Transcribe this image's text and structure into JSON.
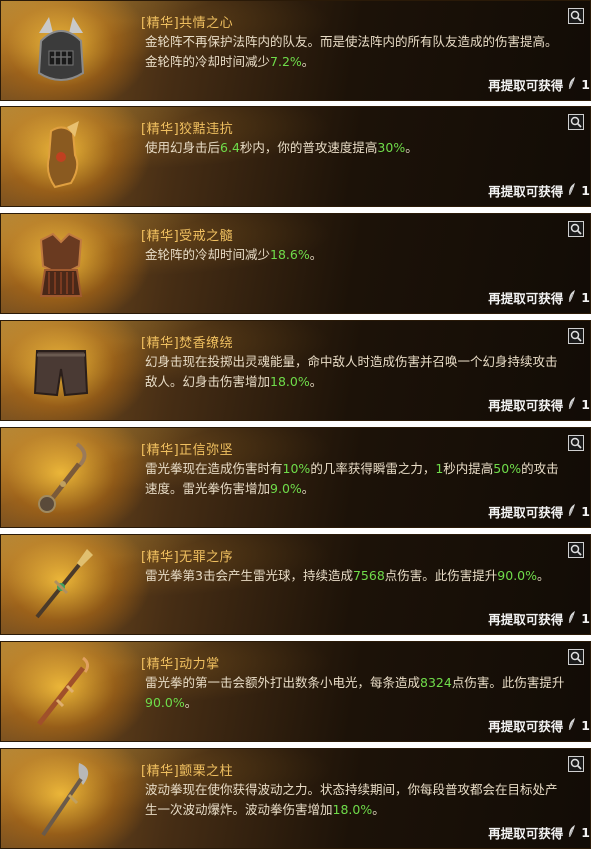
{
  "extract_label": "再提取可获得",
  "extract_count": "1",
  "icons": {
    "search": "search-icon",
    "currency": "feather-icon"
  },
  "colors": {
    "highlight": "#6fdc4a",
    "title": "#f0c060",
    "text": "#e8dcc6"
  },
  "cards": [
    {
      "title": "[精华]共情之心",
      "item_icon": "helmet-icon",
      "desc": [
        {
          "t": "金轮阵不再保护法阵内的队友。而是使法阵内的所有队友造成的伤害提高。金轮阵的冷却时间减少"
        },
        {
          "t": "7.2%",
          "hl": true
        },
        {
          "t": "。"
        }
      ]
    },
    {
      "title": "[精华]狡黠违抗",
      "item_icon": "gloves-icon",
      "desc": [
        {
          "t": "使用幻身击后"
        },
        {
          "t": "6.4",
          "hl": true
        },
        {
          "t": "秒内，你的普攻速度提高"
        },
        {
          "t": "30%",
          "hl": true
        },
        {
          "t": "。"
        }
      ]
    },
    {
      "title": "[精华]受戒之髓",
      "item_icon": "chest-armor-icon",
      "desc": [
        {
          "t": "金轮阵的冷却时间减少"
        },
        {
          "t": "18.6%",
          "hl": true
        },
        {
          "t": "。"
        }
      ]
    },
    {
      "title": "[精华]焚香缭绕",
      "item_icon": "pants-icon",
      "desc": [
        {
          "t": "幻身击现在投掷出灵魂能量，命中敌人时造成伤害并召唤一个幻身持续攻击敌人。幻身击伤害增加"
        },
        {
          "t": "18.0%",
          "hl": true
        },
        {
          "t": "。"
        }
      ]
    },
    {
      "title": "[精华]正信弥坚",
      "item_icon": "mace-icon",
      "desc": [
        {
          "t": "雷光拳现在造成伤害时有"
        },
        {
          "t": "10%",
          "hl": true
        },
        {
          "t": "的几率获得瞬雷之力，"
        },
        {
          "t": "1",
          "hl": true
        },
        {
          "t": "秒内提高"
        },
        {
          "t": "50%",
          "hl": true
        },
        {
          "t": "的攻击速度。雷光拳伤害增加"
        },
        {
          "t": "9.0%",
          "hl": true
        },
        {
          "t": "。"
        }
      ]
    },
    {
      "title": "[精华]无罪之序",
      "item_icon": "spear-icon",
      "desc": [
        {
          "t": "雷光拳第3击会产生雷光球，持续造成"
        },
        {
          "t": "7568",
          "hl": true
        },
        {
          "t": "点伤害。此伤害提升"
        },
        {
          "t": "90.0%",
          "hl": true
        },
        {
          "t": "。"
        }
      ]
    },
    {
      "title": "[精华]动力掌",
      "item_icon": "staff-icon",
      "desc": [
        {
          "t": "雷光拳的第一击会额外打出数条小电光，每条造成"
        },
        {
          "t": "8324",
          "hl": true
        },
        {
          "t": "点伤害。此伤害提升"
        },
        {
          "t": "90.0%",
          "hl": true
        },
        {
          "t": "。"
        }
      ]
    },
    {
      "title": "[精华]颤栗之柱",
      "item_icon": "glaive-icon",
      "desc": [
        {
          "t": "波动拳现在使你获得波动之力。状态持续期间，你每段普攻都会在目标处产生一次波动爆炸。波动拳伤害增加"
        },
        {
          "t": "18.0%",
          "hl": true
        },
        {
          "t": "。"
        }
      ]
    }
  ]
}
